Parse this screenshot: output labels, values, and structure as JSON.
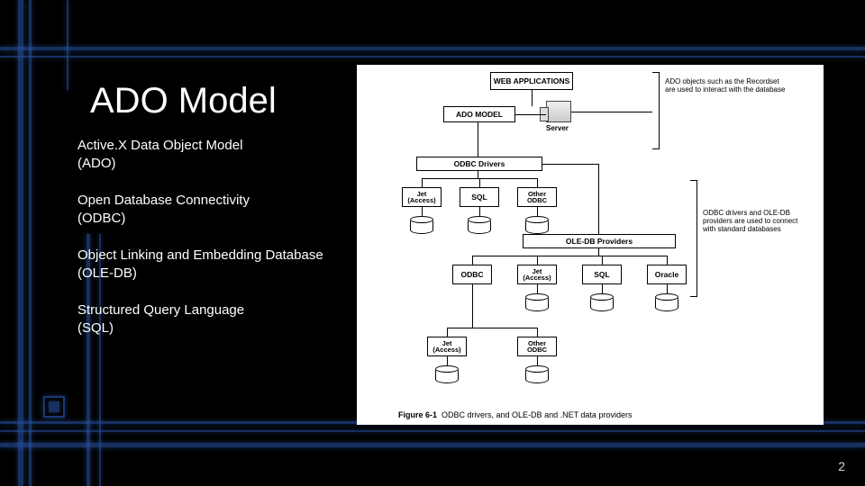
{
  "slide": {
    "title": "ADO Model",
    "page_number": "2"
  },
  "bullets": [
    {
      "name": "Active.X Data Object Model",
      "abbr": "(ADO)"
    },
    {
      "name": "Open Database Connectivity",
      "abbr": "(ODBC)"
    },
    {
      "name": "Object Linking and Embedding Database",
      "abbr": "(OLE-DB)"
    },
    {
      "name": "Structured Query Language",
      "abbr": "(SQL)"
    }
  ],
  "diagram": {
    "top_box": "WEB APPLICATIONS",
    "ado_box": "ADO MODEL",
    "server_label": "Server",
    "odbc_header": "ODBC Drivers",
    "odbc_drivers": [
      "Jet (Access)",
      "SQL",
      "Other ODBC"
    ],
    "oledb_header": "OLE-DB Providers",
    "oledb_providers": [
      "ODBC",
      "Jet (Access)",
      "SQL",
      "Oracle"
    ],
    "under_odbc_provider": [
      "Jet (Access)",
      "Other ODBC"
    ],
    "note_top": "ADO objects such as the Recordset are used to interact with the database",
    "note_bottom": "ODBC drivers and OLE-DB providers are used to connect with standard databases",
    "caption_label": "Figure 6-1",
    "caption_text": "ODBC drivers, and OLE-DB and .NET data providers"
  }
}
